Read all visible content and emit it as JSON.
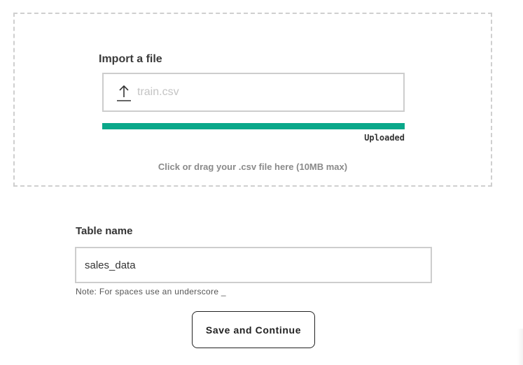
{
  "upload": {
    "label": "Import a file",
    "file_name": "train.csv",
    "progress_percent": 100,
    "status": "Uploaded",
    "hint": "Click or drag your .csv file here (10MB max)",
    "icon": "upload-arrow-icon",
    "accent_color": "#0aa88a"
  },
  "table": {
    "label": "Table name",
    "value": "sales_data",
    "note": "Note: For spaces use an underscore _"
  },
  "actions": {
    "save_label": "Save and Continue"
  }
}
